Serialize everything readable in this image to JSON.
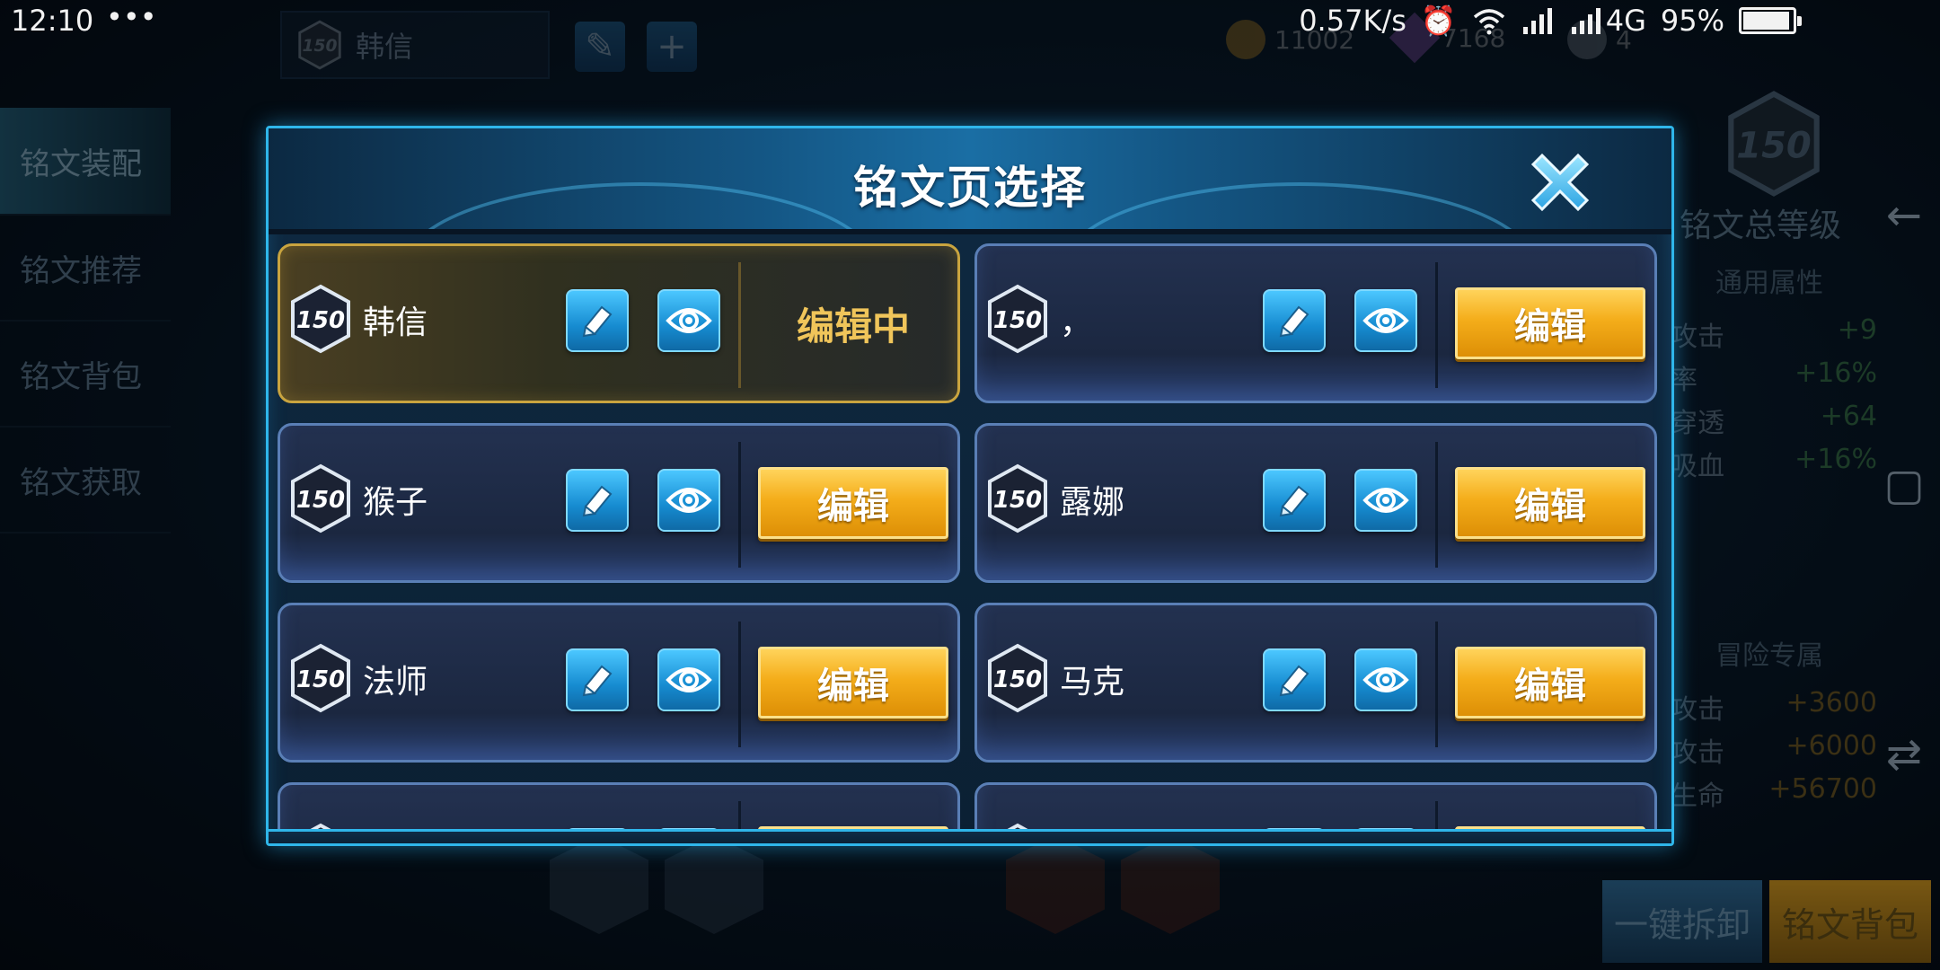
{
  "status_bar": {
    "time": "12:10",
    "dots": "•••",
    "network_speed": "0.57K/s",
    "network_type": "4G",
    "battery": "95%",
    "battery_level": 0.95
  },
  "top_bar": {
    "hero_level": "150",
    "hero_name": "韩信",
    "gold": "11002",
    "gems": "7168",
    "tickets": "4"
  },
  "sidebar": {
    "items": [
      {
        "label": "铭文装配"
      },
      {
        "label": "铭文推荐"
      },
      {
        "label": "铭文背包"
      },
      {
        "label": "铭文获取"
      }
    ]
  },
  "right_panel": {
    "total_level": "150",
    "total_label": "铭文总等级",
    "general_title": "通用属性",
    "general_stats": [
      {
        "key": "攻击",
        "value": "+9"
      },
      {
        "key": "率",
        "value": "+16%"
      },
      {
        "key": "穿透",
        "value": "+64"
      },
      {
        "key": "吸血",
        "value": "+16%"
      }
    ],
    "adventure_title": "冒险专属",
    "adventure_stats": [
      {
        "key": "攻击",
        "value": "+3600"
      },
      {
        "key": "攻击",
        "value": "+6000"
      },
      {
        "key": "生命",
        "value": "+56700"
      }
    ],
    "unload_all": "一键拆卸",
    "rune_bag": "铭文背包"
  },
  "modal": {
    "title": "铭文页选择",
    "edit_label": "编辑",
    "editing_label": "编辑中",
    "pages": [
      {
        "level": "150",
        "name": "韩信",
        "active": true
      },
      {
        "level": "150",
        "name": "，",
        "active": false
      },
      {
        "level": "150",
        "name": "猴子",
        "active": false
      },
      {
        "level": "150",
        "name": "露娜",
        "active": false
      },
      {
        "level": "150",
        "name": "法师",
        "active": false
      },
      {
        "level": "150",
        "name": "马克",
        "active": false
      }
    ]
  },
  "colors": {
    "accent_blue": "#2fb6ea",
    "edit_gold": "#f4ad1a",
    "active_gold": "#c9a43f"
  },
  "icons": [
    "pencil-icon",
    "eye-icon",
    "close-icon",
    "level-hexagon-icon"
  ]
}
